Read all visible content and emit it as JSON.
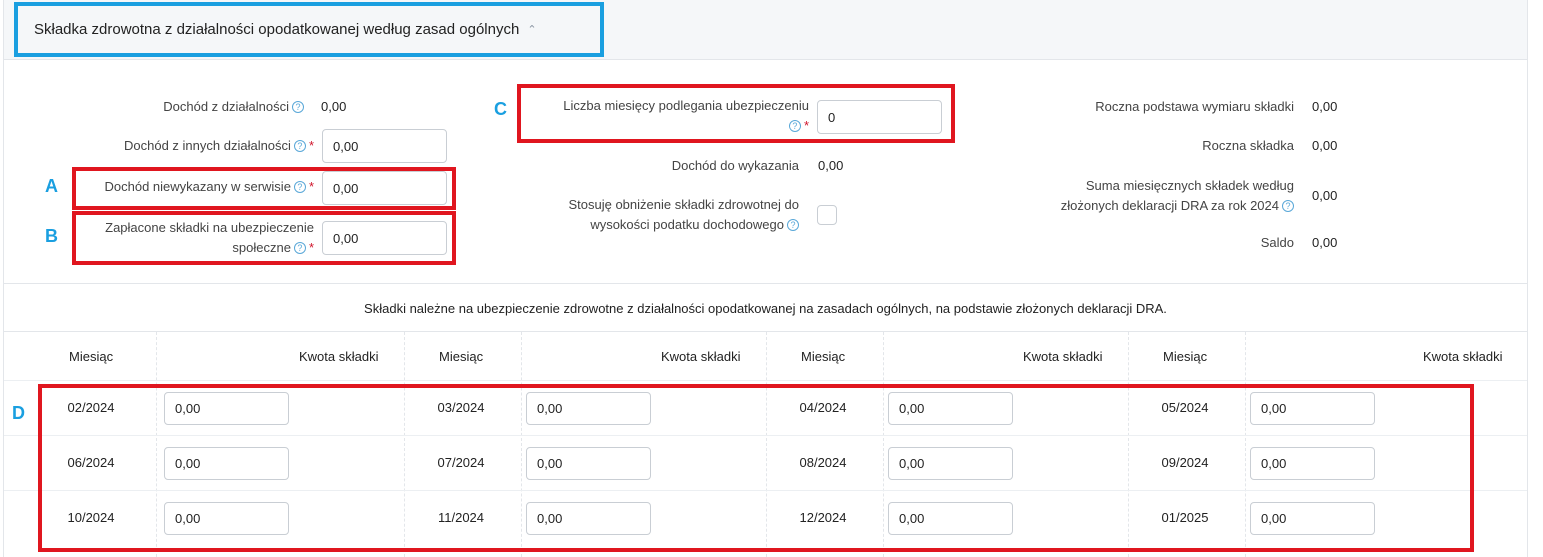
{
  "header": {
    "title": "Składka zdrowotna z działalności opodatkowanej według zasad ogólnych",
    "chevron": "chevron-up-icon"
  },
  "left": {
    "dochod_dzialalnosci": {
      "label": "Dochód z działalności",
      "value": "0,00"
    },
    "dochod_innych": {
      "label": "Dochód z innych działalności",
      "value": "0,00"
    },
    "dochod_niewykazany": {
      "label": "Dochód niewykazany w serwisie",
      "value": "0,00"
    },
    "zaplacone_skladki": {
      "label_line1": "Zapłacone składki na ubezpieczenie",
      "label_line2": "społeczne",
      "value": "0,00"
    }
  },
  "middle": {
    "liczba_miesiecy": {
      "label": "Liczba miesięcy podlegania ubezpieczeniu",
      "value": "0"
    },
    "dochod_do_wykazania": {
      "label": "Dochód do wykazania",
      "value": "0,00"
    },
    "obnizenie": {
      "label_line1": "Stosuję obniżenie składki zdrowotnej do",
      "label_line2": "wysokości podatku dochodowego"
    }
  },
  "right": {
    "roczna_podstawa": {
      "label": "Roczna podstawa wymiaru składki",
      "value": "0,00"
    },
    "roczna_skladka": {
      "label": "Roczna składka",
      "value": "0,00"
    },
    "suma_miesiecznych": {
      "label_line1": "Suma miesięcznych składek według",
      "label_line2": "złożonych deklaracji DRA za rok 2024",
      "value": "0,00"
    },
    "saldo": {
      "label": "Saldo",
      "value": "0,00"
    }
  },
  "annotations": {
    "a": "A",
    "b": "B",
    "c": "C",
    "d": "D"
  },
  "table": {
    "caption": "Składki należne na ubezpieczenie zdrowotne z działalności opodatkowanej na zasadach ogólnych, na podstawie złożonych deklaracji DRA.",
    "col_month": "Miesiąc",
    "col_amount": "Kwota składki",
    "rows": [
      [
        {
          "month": "02/2024",
          "amount": "0,00"
        },
        {
          "month": "03/2024",
          "amount": "0,00"
        },
        {
          "month": "04/2024",
          "amount": "0,00"
        },
        {
          "month": "05/2024",
          "amount": "0,00"
        }
      ],
      [
        {
          "month": "06/2024",
          "amount": "0,00"
        },
        {
          "month": "07/2024",
          "amount": "0,00"
        },
        {
          "month": "08/2024",
          "amount": "0,00"
        },
        {
          "month": "09/2024",
          "amount": "0,00"
        }
      ],
      [
        {
          "month": "10/2024",
          "amount": "0,00"
        },
        {
          "month": "11/2024",
          "amount": "0,00"
        },
        {
          "month": "12/2024",
          "amount": "0,00"
        },
        {
          "month": "01/2025",
          "amount": "0,00"
        }
      ]
    ]
  },
  "colors": {
    "annotation_red": "#e0161f",
    "annotation_blue": "#1a9fe0"
  }
}
